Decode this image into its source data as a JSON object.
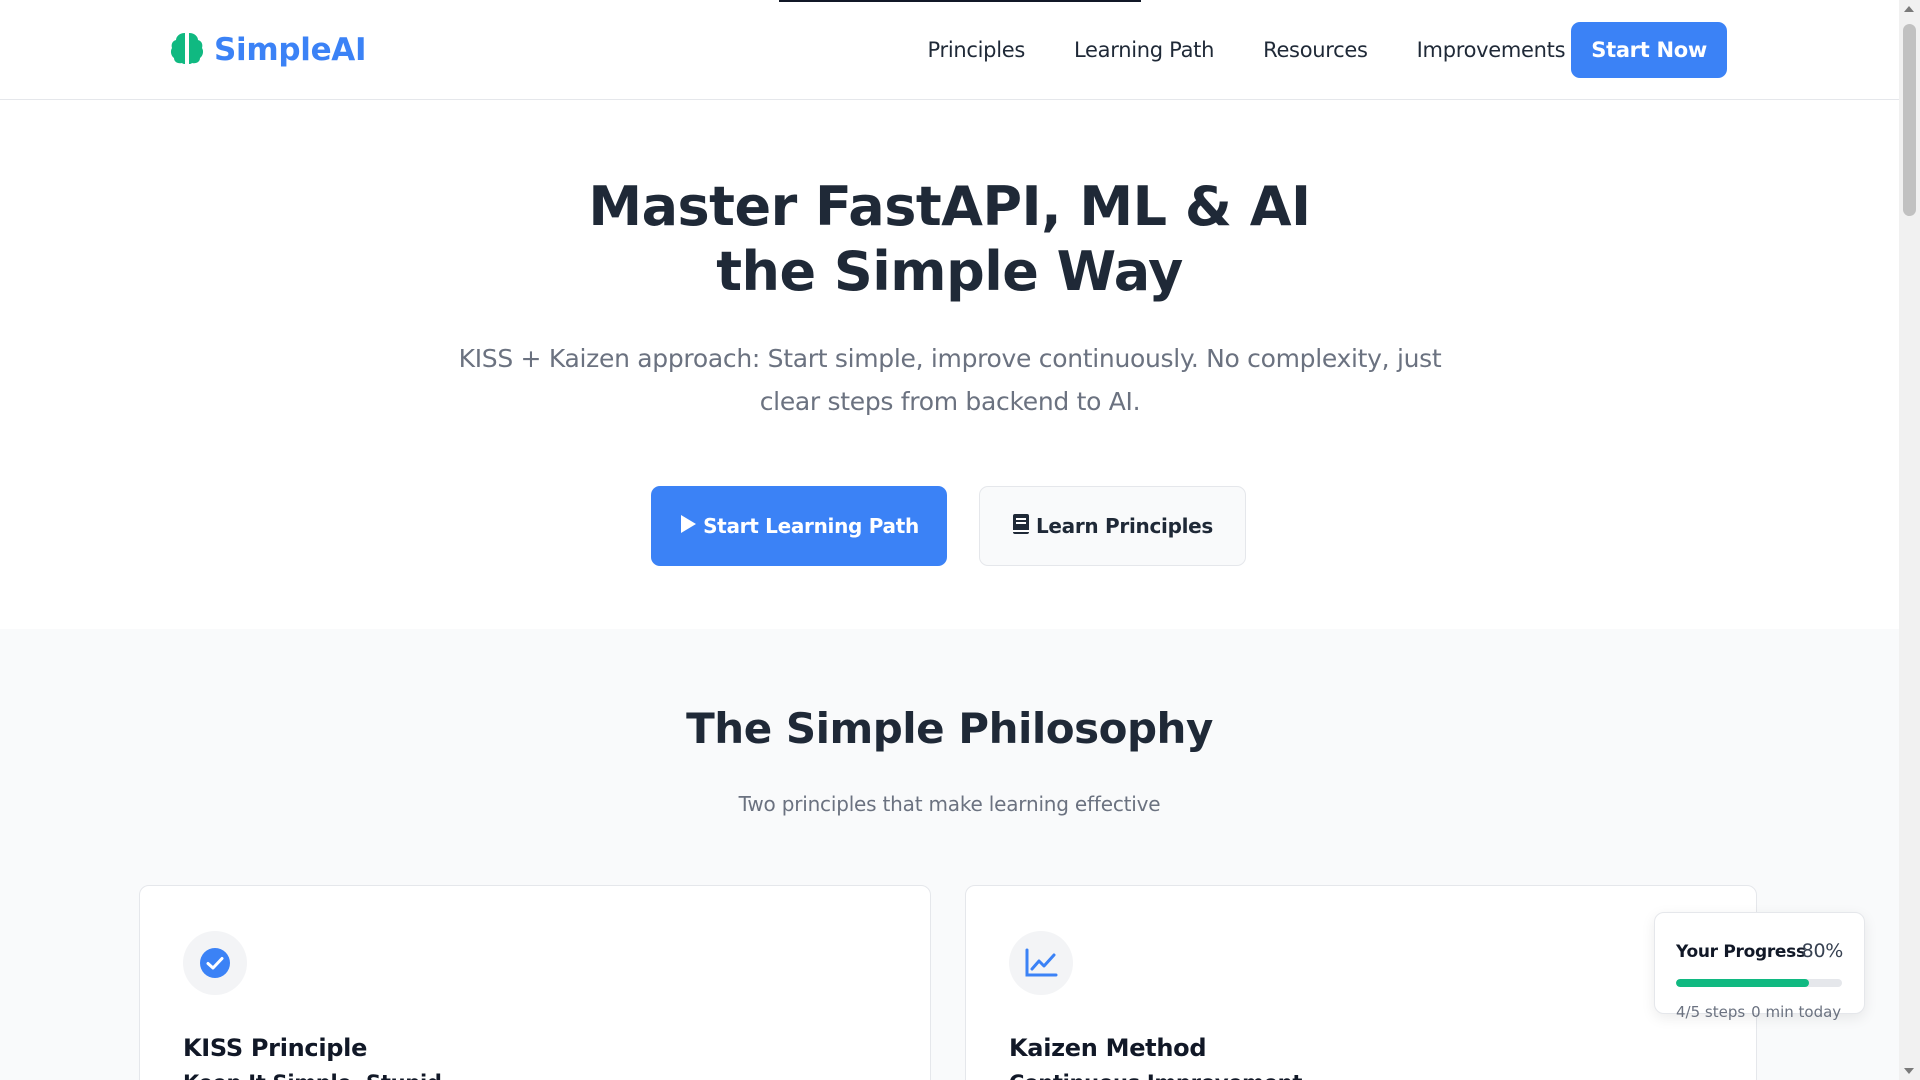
{
  "brand": {
    "name": "SimpleAI",
    "logo_icon": "brain-icon",
    "accent_color": "#3b82f6",
    "logo_color": "#10b981"
  },
  "nav": {
    "items": [
      {
        "label": "Principles"
      },
      {
        "label": "Learning Path"
      },
      {
        "label": "Resources"
      },
      {
        "label": "Improvements"
      }
    ],
    "cta_label": "Start Now"
  },
  "hero": {
    "title_line1": "Master FastAPI, ML & AI",
    "title_line2": "the Simple Way",
    "subtitle": "KISS + Kaizen approach: Start simple, improve continuously. No complexity, just clear steps from backend to AI.",
    "primary_button": {
      "label": "Start Learning Path",
      "icon": "play-icon"
    },
    "secondary_button": {
      "label": "Learn Principles",
      "icon": "book-icon"
    }
  },
  "philosophy": {
    "title": "The Simple Philosophy",
    "subtitle": "Two principles that make learning effective",
    "cards": [
      {
        "icon": "check-circle-icon",
        "title": "KISS Principle",
        "subtitle": "Keep It Simple, Stupid"
      },
      {
        "icon": "chart-line-icon",
        "title": "Kaizen Method",
        "subtitle": "Continuous Improvement"
      }
    ]
  },
  "progress": {
    "title": "Your Progress",
    "percent_label": "80%",
    "percent_value": 0.8,
    "steps_label": "4/5 steps",
    "time_label": "0 min today",
    "bar_color": "#10b981"
  }
}
